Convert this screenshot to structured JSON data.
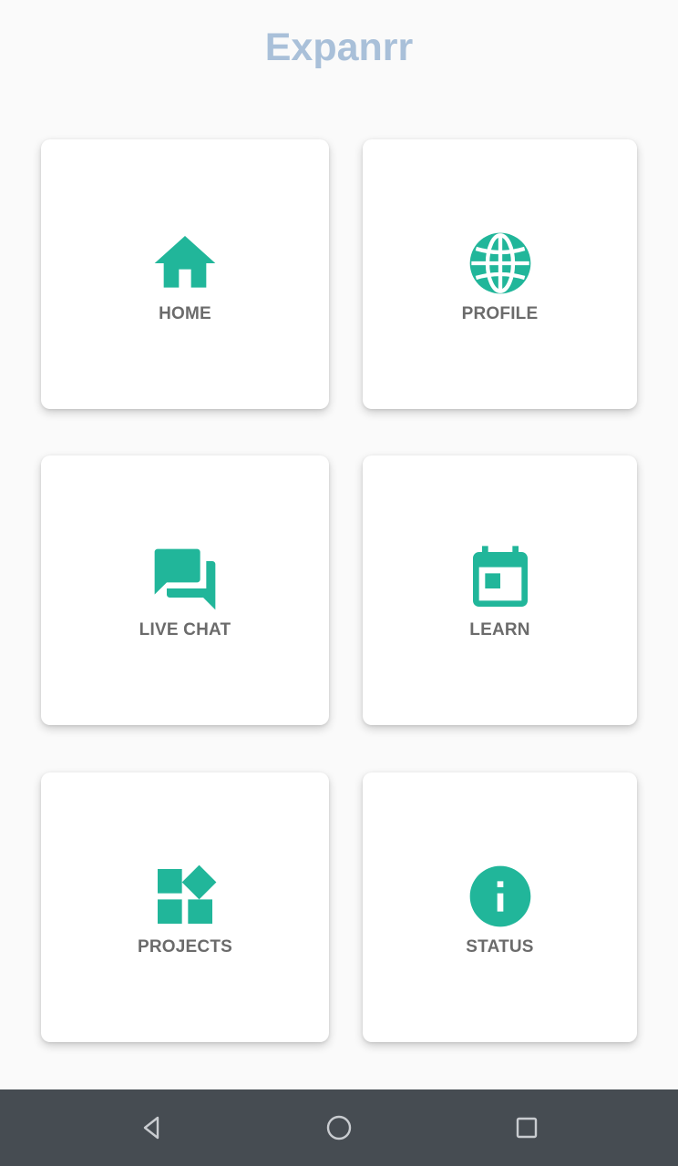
{
  "app": {
    "title": "Expanrr",
    "title_color": "#a9c0d9"
  },
  "colors": {
    "accent": "#21b69a",
    "label": "#6b6b6b",
    "card_bg": "#ffffff",
    "page_bg": "#fafafa",
    "navbar_bg": "#464c52",
    "navbar_icon": "#c9ccd0"
  },
  "menu": {
    "items": [
      {
        "label": "HOME",
        "icon": "home-icon"
      },
      {
        "label": "PROFILE",
        "icon": "globe-icon"
      },
      {
        "label": "LIVE CHAT",
        "icon": "chat-bubbles-icon"
      },
      {
        "label": "LEARN",
        "icon": "calendar-icon"
      },
      {
        "label": "PROJECTS",
        "icon": "widgets-icon"
      },
      {
        "label": "STATUS",
        "icon": "info-icon"
      }
    ]
  },
  "navbar": {
    "buttons": [
      "back-icon",
      "home-circle-icon",
      "recents-icon"
    ]
  }
}
